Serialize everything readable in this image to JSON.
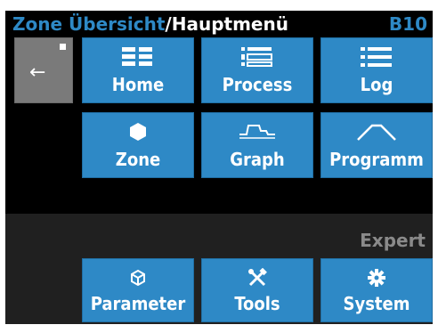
{
  "header": {
    "breadcrumb_zone": "Zone Übersicht",
    "separator": "/",
    "breadcrumb_menu": "Hauptmenü",
    "code": "B10"
  },
  "buttons": {
    "home": "Home",
    "process": "Process",
    "log": "Log",
    "zone": "Zone",
    "graph": "Graph",
    "programm": "Programm"
  },
  "expert": {
    "title": "Expert",
    "parameter": "Parameter",
    "tools": "Tools",
    "system": "System"
  }
}
